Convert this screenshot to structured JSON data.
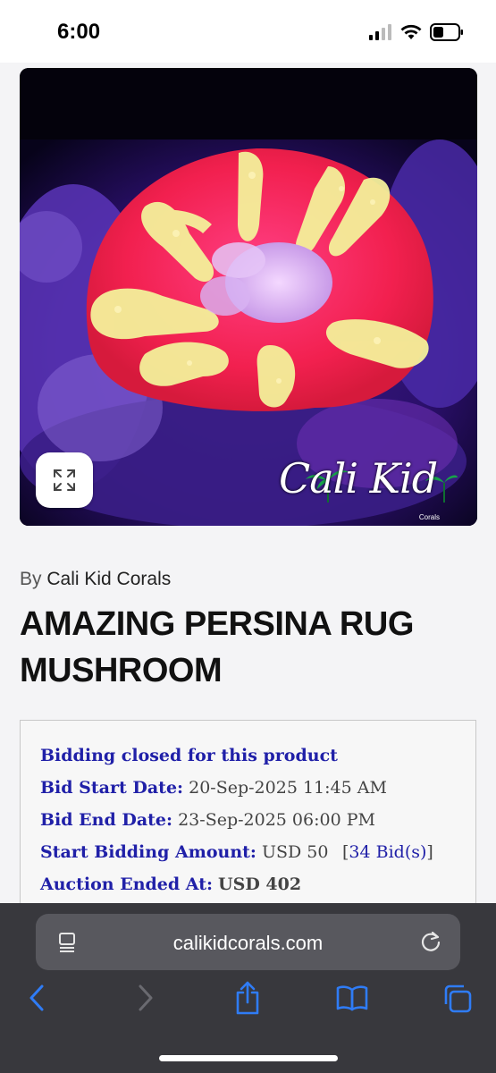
{
  "status_bar": {
    "time": "6:00"
  },
  "product": {
    "watermark_main": "Cali Kid",
    "watermark_sub": "Corals",
    "seller_prefix": "By",
    "seller_name": "Cali Kid Corals",
    "title": "AMAZING PERSINA RUG MUSHROOM"
  },
  "auction": {
    "status": "Bidding closed for this product",
    "bid_start_label": "Bid Start Date:",
    "bid_start_value": "20-Sep-2025 11:45 AM",
    "bid_end_label": "Bid End Date:",
    "bid_end_value": "23-Sep-2025 06:00 PM",
    "start_amount_label": "Start Bidding Amount:",
    "start_amount_value": "USD 50",
    "bids_count": "34 Bid(s)",
    "ended_label": "Auction Ended At:",
    "ended_value": "USD 402"
  },
  "browser": {
    "url": "calikidcorals.com",
    "icons": [
      "reader-icon",
      "reload-icon",
      "back-icon",
      "forward-icon",
      "share-icon",
      "bookmarks-icon",
      "tabs-icon"
    ]
  },
  "colors": {
    "link_blue": "#2020a8",
    "browser_chrome": "#38383d",
    "toolbar_icon_blue": "#2f7cf6"
  }
}
